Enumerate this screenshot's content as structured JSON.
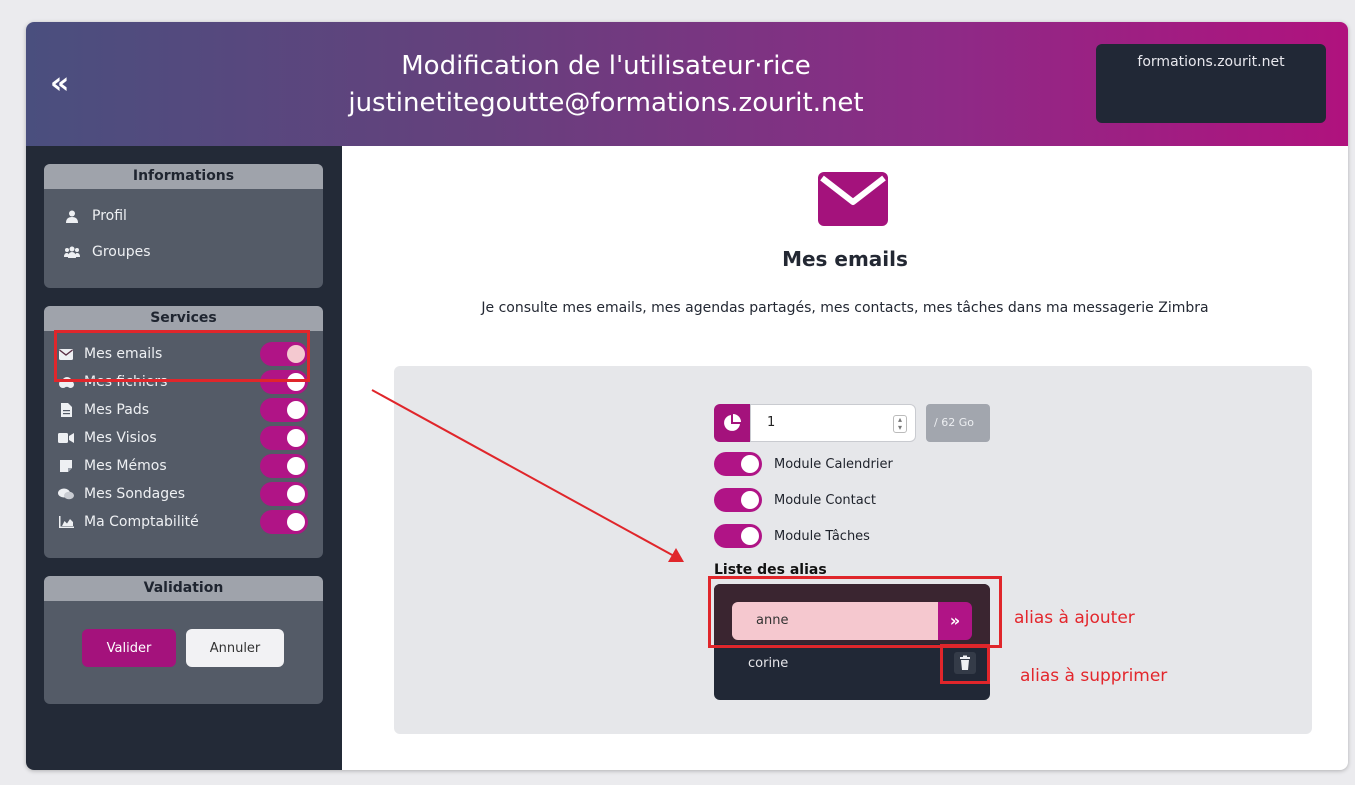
{
  "header": {
    "back_label": "«",
    "title_line1": "Modification de l'utilisateur·rice",
    "title_line2": "justinetitegoutte@formations.zourit.net",
    "domain": "formations.zourit.net"
  },
  "sidebar": {
    "informations": {
      "title": "Informations",
      "items": [
        {
          "label": "Profil",
          "icon": "user-icon"
        },
        {
          "label": "Groupes",
          "icon": "users-icon"
        }
      ]
    },
    "services": {
      "title": "Services",
      "items": [
        {
          "label": "Mes emails",
          "icon": "envelope-icon",
          "enabled": true
        },
        {
          "label": "Mes fichiers",
          "icon": "cloud-icon",
          "enabled": true
        },
        {
          "label": "Mes Pads",
          "icon": "file-icon",
          "enabled": true
        },
        {
          "label": "Mes Visios",
          "icon": "video-icon",
          "enabled": true
        },
        {
          "label": "Mes Mémos",
          "icon": "note-icon",
          "enabled": true
        },
        {
          "label": "Mes Sondages",
          "icon": "comments-icon",
          "enabled": true
        },
        {
          "label": "Ma Comptabilité",
          "icon": "chart-area-icon",
          "enabled": true
        }
      ]
    },
    "validation": {
      "title": "Validation",
      "valider": "Valider",
      "annuler": "Annuler"
    }
  },
  "main": {
    "title": "Mes emails",
    "description": "Je consulte mes emails, mes agendas partagés, mes contacts, mes tâches dans ma messagerie Zimbra",
    "quota": {
      "value": "1",
      "unit": "/ 62 Go"
    },
    "modules": [
      {
        "label": "Module Calendrier",
        "enabled": true
      },
      {
        "label": "Module Contact",
        "enabled": true
      },
      {
        "label": "Module Tâches",
        "enabled": true
      }
    ],
    "alias": {
      "title": "Liste des alias",
      "input_value": "anne",
      "add_label": "»",
      "items": [
        "corine"
      ]
    }
  },
  "annotations": {
    "add_note": "alias à ajouter",
    "delete_note": "alias à supprimer"
  },
  "colors": {
    "accent": "#b01486",
    "sidebar_bg": "#232a37",
    "annotation_red": "#e0262b"
  }
}
